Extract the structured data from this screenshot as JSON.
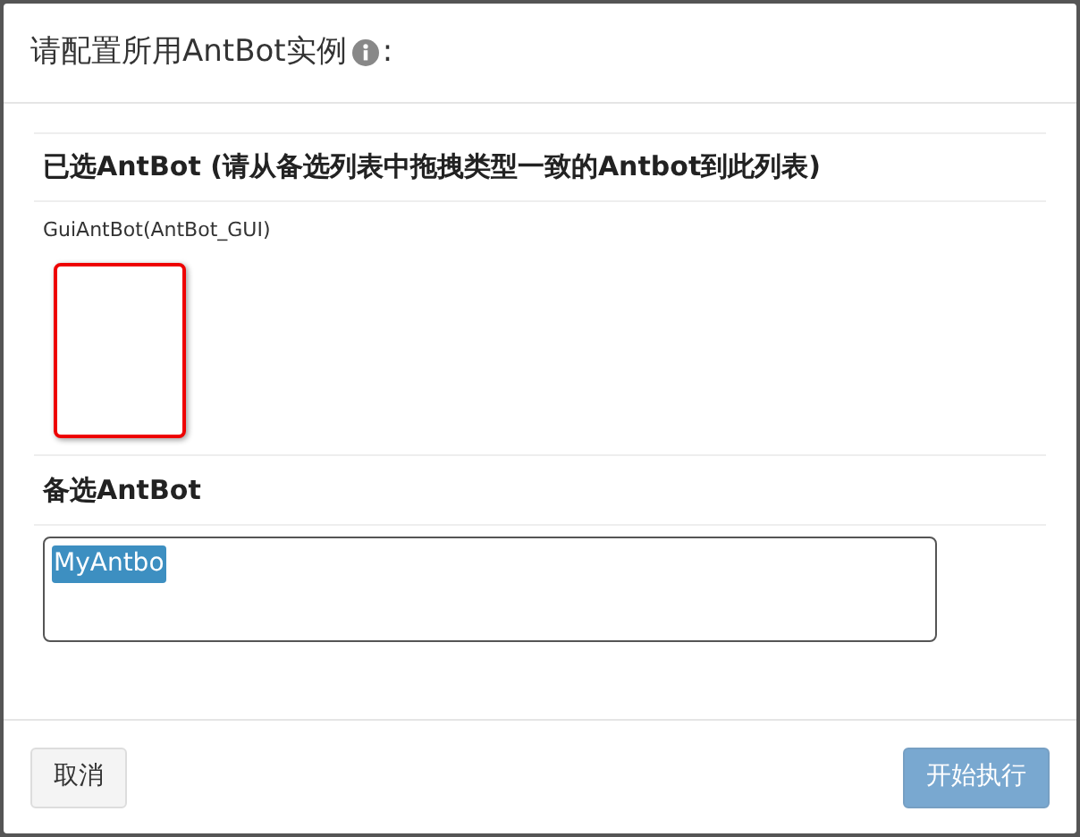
{
  "dialog": {
    "title": "请配置所用AntBot实例",
    "title_suffix": ":"
  },
  "selected_section": {
    "heading": "已选AntBot (请从备选列表中拖拽类型一致的Antbot到此列表)",
    "slots": [
      {
        "label": "GuiAntBot(AntBot_GUI)",
        "highlighted": true
      }
    ]
  },
  "candidate_section": {
    "heading": "备选AntBot",
    "items": [
      {
        "label": "MyAntbo",
        "selected": true
      }
    ]
  },
  "buttons": [
    {
      "label": "取消",
      "kind": "default",
      "disabled": false
    },
    {
      "label": "开始执行",
      "kind": "primary",
      "disabled": true
    }
  ]
}
